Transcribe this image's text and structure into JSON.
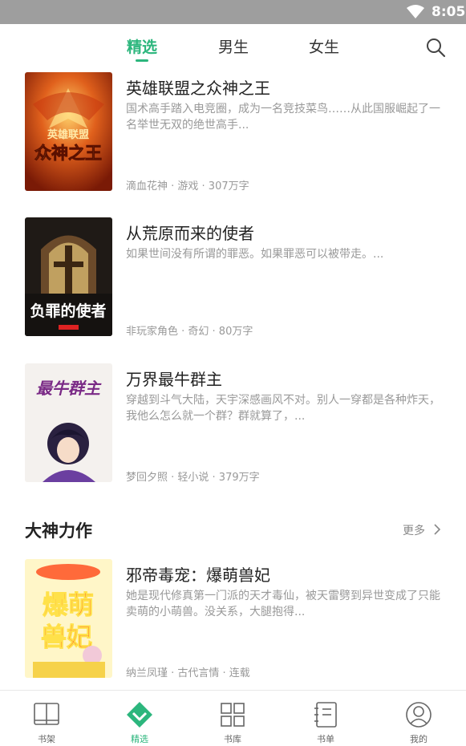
{
  "status": {
    "time": "8:05"
  },
  "tabs": [
    {
      "label": "精选",
      "active": true
    },
    {
      "label": "男生",
      "active": false
    },
    {
      "label": "女生",
      "active": false
    }
  ],
  "books": [
    {
      "title": "英雄联盟之众神之王",
      "desc": "国术高手踏入电竞圈，成为一名竞技菜鸟……从此国服崛起了一名举世无双的绝世高手...",
      "meta": "滴血花神 · 游戏 · 307万字",
      "cover_text": "英雄联盟 众神之王"
    },
    {
      "title": "从荒原而来的使者",
      "desc": "如果世间没有所谓的罪恶。如果罪恶可以被带走。...",
      "meta": "非玩家角色 · 奇幻 · 80万字",
      "cover_text": "负罪的使者"
    },
    {
      "title": "万界最牛群主",
      "desc": "穿越到斗气大陆，天宇深感画风不对。别人一穿都是各种炸天，我他么怎么就一个群？群就算了，...",
      "meta": "梦回夕照 · 轻小说 · 379万字",
      "cover_text": "最牛群主"
    }
  ],
  "section": {
    "title": "大神力作",
    "more": "更多"
  },
  "featured": {
    "title": "邪帝毒宠：爆萌兽妃",
    "desc": "她是现代修真第一门派的天才毒仙，被天雷劈到异世变成了只能卖萌的小萌兽。没关系，大腿抱得...",
    "meta": "纳兰凤瑾 · 古代言情 · 连载",
    "cover_text": "爆萌兽妃"
  },
  "bottom_nav": [
    {
      "label": "书架",
      "icon": "bookshelf-icon",
      "active": false
    },
    {
      "label": "精选",
      "icon": "diamond-icon",
      "active": true
    },
    {
      "label": "书库",
      "icon": "grid-icon",
      "active": false
    },
    {
      "label": "书单",
      "icon": "notebook-icon",
      "active": false
    },
    {
      "label": "我的",
      "icon": "user-icon",
      "active": false
    }
  ],
  "colors": {
    "accent": "#2cb67d",
    "statusbar": "#9e9e9e",
    "secondary_text": "#999999"
  }
}
